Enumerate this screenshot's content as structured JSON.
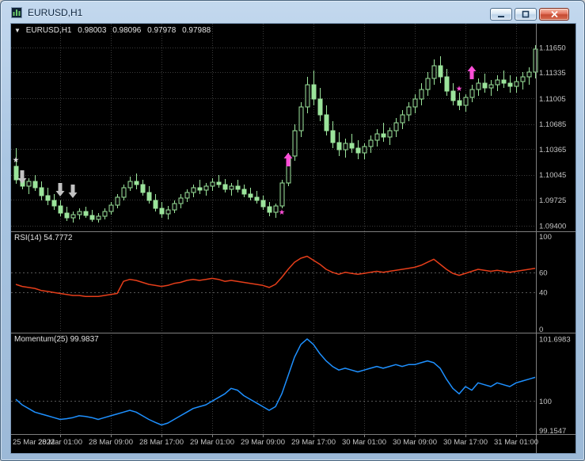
{
  "window": {
    "title": "EURUSD,H1"
  },
  "chart": {
    "collapse_icon": "▼",
    "symbol_period": "EURUSD,H1",
    "open": "0.98003",
    "high": "0.98096",
    "low": "0.97978",
    "close": "0.97988"
  },
  "chart_data": {
    "type": "candlestick",
    "symbol": "EURUSD",
    "timeframe": "H1",
    "colors": {
      "background": "#000000",
      "grid": "#3C3C3C",
      "level": "#565656",
      "separator": "#7E7E7E",
      "candle": "#9BE49B",
      "candle_bull_fill": "#0A0A0A",
      "text": "#C6C6C6",
      "buy_signal": "#FF4FD8",
      "sell_signal": "#C2C2C2"
    },
    "main_panel": {
      "price_range": [
        1.0933,
        1.1195
      ],
      "price_ticks": [
        "1.11650",
        "1.11335",
        "1.11005",
        "1.10685",
        "1.10365",
        "1.10045",
        "1.09725",
        "1.09400"
      ],
      "candles_ohlc": [
        [
          1.1015,
          1.1038,
          1.0993,
          1.0998
        ],
        [
          1.0998,
          1.1008,
          1.0986,
          1.099
        ],
        [
          1.099,
          1.1,
          1.098,
          1.0996
        ],
        [
          1.0996,
          1.1004,
          1.0984,
          1.0988
        ],
        [
          1.0988,
          1.0996,
          1.0972,
          1.0978
        ],
        [
          1.0978,
          1.0988,
          1.0966,
          1.0972
        ],
        [
          1.0972,
          1.098,
          1.096,
          1.0965
        ],
        [
          1.0965,
          1.0972,
          1.0952,
          1.0956
        ],
        [
          1.0956,
          1.0964,
          1.0946,
          1.095
        ],
        [
          1.095,
          1.0958,
          1.0944,
          1.0954
        ],
        [
          1.0954,
          1.0962,
          1.0948,
          1.0958
        ],
        [
          1.0958,
          1.0964,
          1.095,
          1.0953
        ],
        [
          1.0953,
          1.096,
          1.0945,
          1.0948
        ],
        [
          1.0948,
          1.0956,
          1.0944,
          1.0952
        ],
        [
          1.0952,
          1.0962,
          1.0948,
          1.0958
        ],
        [
          1.0958,
          1.097,
          1.0954,
          1.0966
        ],
        [
          1.0966,
          1.098,
          1.0962,
          1.0976
        ],
        [
          1.0976,
          1.0992,
          1.0972,
          1.0988
        ],
        [
          1.0988,
          1.1002,
          1.0984,
          1.0996
        ],
        [
          1.0996,
          1.1006,
          1.0986,
          1.0992
        ],
        [
          1.0992,
          1.0998,
          1.0978,
          1.0982
        ],
        [
          1.0982,
          1.099,
          1.0968,
          1.0972
        ],
        [
          1.0972,
          1.098,
          1.0958,
          1.0962
        ],
        [
          1.0962,
          1.097,
          1.095,
          1.0955
        ],
        [
          1.0955,
          1.0965,
          1.0948,
          1.096
        ],
        [
          1.096,
          1.0972,
          1.0956,
          1.0968
        ],
        [
          1.0968,
          1.098,
          1.0962,
          1.0975
        ],
        [
          1.0975,
          1.0986,
          1.097,
          1.0982
        ],
        [
          1.0982,
          1.0992,
          1.0976,
          1.0988
        ],
        [
          1.0988,
          1.0998,
          1.098,
          1.0985
        ],
        [
          1.0985,
          1.0994,
          1.0978,
          1.099
        ],
        [
          1.099,
          1.1,
          1.0984,
          1.0995
        ],
        [
          1.0995,
          1.1004,
          1.0988,
          1.0992
        ],
        [
          1.0992,
          1.0999,
          1.0982,
          1.0986
        ],
        [
          1.0986,
          1.0994,
          1.0978,
          1.099
        ],
        [
          1.099,
          1.0998,
          1.0982,
          1.0986
        ],
        [
          1.0986,
          1.0992,
          1.0976,
          1.098
        ],
        [
          1.098,
          1.0988,
          1.0972,
          1.0976
        ],
        [
          1.0976,
          1.0984,
          1.0968,
          1.0972
        ],
        [
          1.0972,
          1.0978,
          1.096,
          1.0964
        ],
        [
          1.0964,
          1.097,
          1.0952,
          1.0957
        ],
        [
          1.0957,
          1.0968,
          1.095,
          1.0965
        ],
        [
          1.0965,
          1.0998,
          1.0962,
          1.0994
        ],
        [
          1.0994,
          1.1032,
          1.099,
          1.1028
        ],
        [
          1.1028,
          1.1068,
          1.1022,
          1.106
        ],
        [
          1.106,
          1.1096,
          1.1052,
          1.109
        ],
        [
          1.109,
          1.1128,
          1.1082,
          1.1118
        ],
        [
          1.1118,
          1.1136,
          1.1092,
          1.11
        ],
        [
          1.11,
          1.1114,
          1.1072,
          1.108
        ],
        [
          1.108,
          1.1092,
          1.1054,
          1.106
        ],
        [
          1.106,
          1.1072,
          1.1038,
          1.1045
        ],
        [
          1.1045,
          1.1058,
          1.1028,
          1.1036
        ],
        [
          1.1036,
          1.105,
          1.1026,
          1.1044
        ],
        [
          1.1044,
          1.1056,
          1.1032,
          1.1038
        ],
        [
          1.1038,
          1.1048,
          1.1024,
          1.1032
        ],
        [
          1.1032,
          1.1044,
          1.1024,
          1.104
        ],
        [
          1.104,
          1.1054,
          1.1032,
          1.1048
        ],
        [
          1.1048,
          1.1062,
          1.104,
          1.1056
        ],
        [
          1.1056,
          1.107,
          1.1046,
          1.1052
        ],
        [
          1.1052,
          1.1064,
          1.1042,
          1.106
        ],
        [
          1.106,
          1.1076,
          1.1052,
          1.107
        ],
        [
          1.107,
          1.1086,
          1.1062,
          1.108
        ],
        [
          1.108,
          1.1096,
          1.1072,
          1.109
        ],
        [
          1.109,
          1.1106,
          1.1082,
          1.11
        ],
        [
          1.11,
          1.112,
          1.1092,
          1.1112
        ],
        [
          1.1112,
          1.1134,
          1.1104,
          1.1126
        ],
        [
          1.1126,
          1.115,
          1.1118,
          1.1142
        ],
        [
          1.1142,
          1.1154,
          1.112,
          1.1128
        ],
        [
          1.1128,
          1.1138,
          1.1104,
          1.111
        ],
        [
          1.111,
          1.112,
          1.1092,
          1.1098
        ],
        [
          1.1098,
          1.1108,
          1.1086,
          1.1092
        ],
        [
          1.1092,
          1.1106,
          1.1084,
          1.1102
        ],
        [
          1.1102,
          1.1118,
          1.1096,
          1.1112
        ],
        [
          1.1112,
          1.1126,
          1.1104,
          1.112
        ],
        [
          1.112,
          1.1132,
          1.1108,
          1.1114
        ],
        [
          1.1114,
          1.1124,
          1.1104,
          1.1118
        ],
        [
          1.1118,
          1.113,
          1.111,
          1.1124
        ],
        [
          1.1124,
          1.1136,
          1.1114,
          1.112
        ],
        [
          1.112,
          1.113,
          1.1108,
          1.1116
        ],
        [
          1.1116,
          1.1128,
          1.1108,
          1.1122
        ],
        [
          1.1122,
          1.1134,
          1.1112,
          1.1128
        ],
        [
          1.1128,
          1.114,
          1.1118,
          1.1134
        ],
        [
          1.1134,
          1.1168,
          1.1126,
          1.1163
        ]
      ]
    },
    "rsi_panel": {
      "label": "RSI(14) 54.7772",
      "range": [
        0,
        100
      ],
      "ticks": [
        "100",
        "60",
        "40",
        "0"
      ],
      "levels": [
        60,
        40
      ],
      "color": "#E63E1A",
      "values": [
        48,
        46,
        45,
        44,
        42,
        41,
        40,
        39,
        38,
        37,
        37,
        36,
        36,
        36,
        37,
        38,
        39,
        51,
        53,
        52,
        50,
        48,
        47,
        46,
        47,
        49,
        50,
        52,
        53,
        52,
        53,
        54,
        53,
        51,
        52,
        51,
        50,
        49,
        48,
        47,
        45,
        48,
        55,
        63,
        70,
        74,
        76,
        72,
        68,
        63,
        60,
        58,
        60,
        59,
        58,
        59,
        60,
        61,
        60,
        61,
        62,
        63,
        64,
        65,
        67,
        70,
        73,
        68,
        63,
        59,
        57,
        59,
        61,
        63,
        62,
        61,
        62,
        61,
        60,
        61,
        62,
        63,
        64
      ]
    },
    "momentum_panel": {
      "label": "Momentum(25) 99.9837",
      "range": [
        99.1,
        101.85
      ],
      "ticks": [
        "101.6983",
        "100",
        "99.1547"
      ],
      "levels": [
        100
      ],
      "color": "#1E90FF",
      "values": [
        100.05,
        99.9,
        99.8,
        99.7,
        99.65,
        99.6,
        99.55,
        99.5,
        99.52,
        99.55,
        99.6,
        99.58,
        99.55,
        99.5,
        99.55,
        99.6,
        99.65,
        99.7,
        99.75,
        99.7,
        99.6,
        99.5,
        99.42,
        99.35,
        99.4,
        99.5,
        99.6,
        99.7,
        99.8,
        99.85,
        99.9,
        100.0,
        100.1,
        100.2,
        100.35,
        100.3,
        100.15,
        100.05,
        99.95,
        99.85,
        99.75,
        99.85,
        100.2,
        100.7,
        101.2,
        101.55,
        101.7,
        101.55,
        101.3,
        101.1,
        100.95,
        100.85,
        100.9,
        100.85,
        100.8,
        100.85,
        100.9,
        100.95,
        100.9,
        100.95,
        101.0,
        100.95,
        101.0,
        101.0,
        101.05,
        101.1,
        101.05,
        100.9,
        100.6,
        100.35,
        100.2,
        100.4,
        100.3,
        100.5,
        100.45,
        100.4,
        100.5,
        100.45,
        100.4,
        100.5,
        100.55,
        100.6,
        100.65
      ]
    },
    "time_axis": {
      "labels": [
        {
          "index": 0,
          "text": "25 Mar 2022",
          "grid": false
        },
        {
          "index": 7,
          "text": "28 Mar 01:00",
          "grid": true
        },
        {
          "index": 15,
          "text": "28 Mar 09:00",
          "grid": true
        },
        {
          "index": 23,
          "text": "28 Mar 17:00",
          "grid": true
        },
        {
          "index": 31,
          "text": "29 Mar 01:00",
          "grid": true
        },
        {
          "index": 39,
          "text": "29 Mar 09:00",
          "grid": true
        },
        {
          "index": 47,
          "text": "29 Mar 17:00",
          "grid": true
        },
        {
          "index": 55,
          "text": "30 Mar 01:00",
          "grid": true
        },
        {
          "index": 63,
          "text": "30 Mar 09:00",
          "grid": true
        },
        {
          "index": 71,
          "text": "30 Mar 17:00",
          "grid": true
        },
        {
          "index": 79,
          "text": "31 Mar 01:00",
          "grid": true
        }
      ]
    },
    "markers": [
      {
        "type": "star",
        "index": 0,
        "price": 1.1024,
        "color": "#E0E0E0"
      },
      {
        "type": "arrow-down",
        "index": 1,
        "price": 1.0993,
        "color": "#C2C2C2"
      },
      {
        "type": "arrow-down",
        "index": 7,
        "price": 1.0977,
        "color": "#C2C2C2"
      },
      {
        "type": "arrow-down",
        "index": 9,
        "price": 1.0975,
        "color": "#C2C2C2"
      },
      {
        "type": "star",
        "index": 42,
        "price": 1.0958,
        "color": "#FF4FD8"
      },
      {
        "type": "arrow-up",
        "index": 43,
        "price": 1.1032,
        "color": "#FF4FD8"
      },
      {
        "type": "star",
        "index": 70,
        "price": 1.1114,
        "color": "#FF4FD8"
      },
      {
        "type": "arrow-up",
        "index": 72,
        "price": 1.1142,
        "color": "#FF4FD8"
      }
    ]
  }
}
